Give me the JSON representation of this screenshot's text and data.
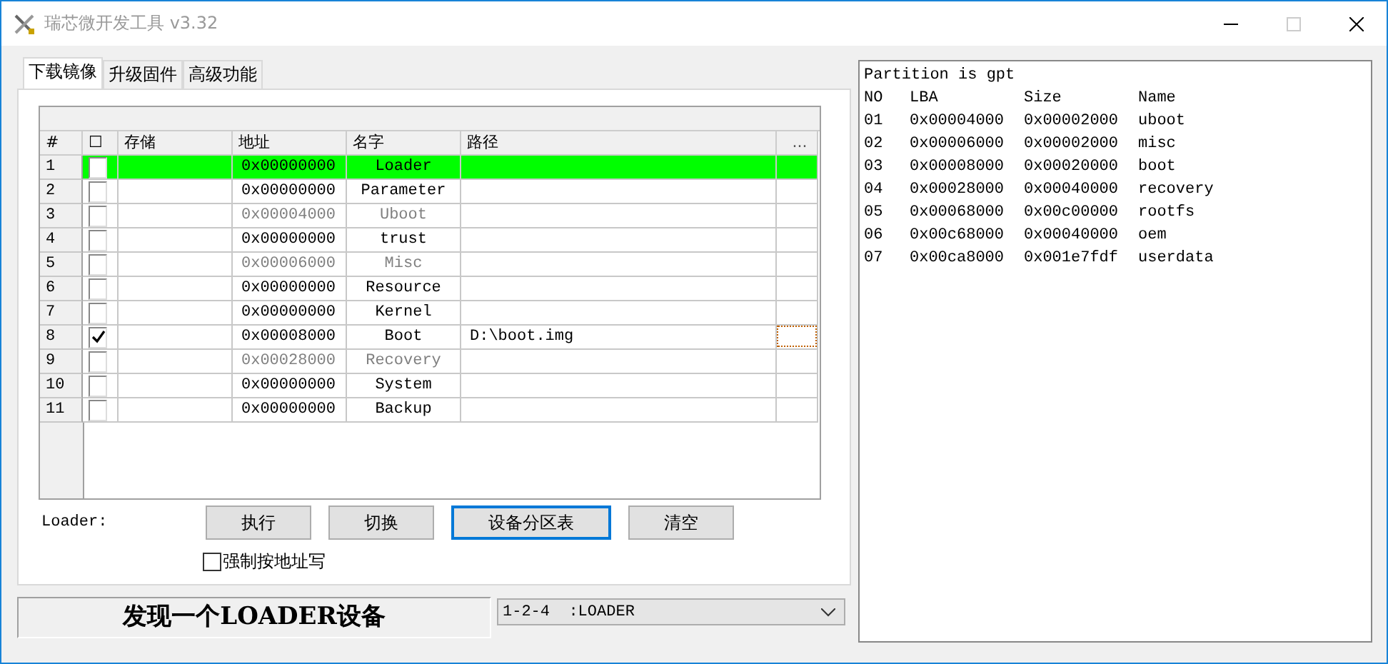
{
  "window": {
    "title": "瑞芯微开发工具 v3.32"
  },
  "tabs": [
    {
      "label": "下载镜像",
      "selected": true
    },
    {
      "label": "升级固件",
      "selected": false
    },
    {
      "label": "高级功能",
      "selected": false
    }
  ],
  "table": {
    "columns": [
      "#",
      "☐",
      "存储",
      "地址",
      "名字",
      "路径",
      "..."
    ],
    "rows": [
      {
        "no": "1",
        "checked": false,
        "selected": true,
        "disabled": false,
        "focused": false,
        "address": "0x00000000",
        "name": "Loader",
        "path": ""
      },
      {
        "no": "2",
        "checked": false,
        "selected": false,
        "disabled": false,
        "focused": false,
        "address": "0x00000000",
        "name": "Parameter",
        "path": ""
      },
      {
        "no": "3",
        "checked": false,
        "selected": false,
        "disabled": true,
        "focused": false,
        "address": "0x00004000",
        "name": "Uboot",
        "path": ""
      },
      {
        "no": "4",
        "checked": false,
        "selected": false,
        "disabled": false,
        "focused": false,
        "address": "0x00000000",
        "name": "trust",
        "path": ""
      },
      {
        "no": "5",
        "checked": false,
        "selected": false,
        "disabled": true,
        "focused": false,
        "address": "0x00006000",
        "name": "Misc",
        "path": ""
      },
      {
        "no": "6",
        "checked": false,
        "selected": false,
        "disabled": false,
        "focused": false,
        "address": "0x00000000",
        "name": "Resource",
        "path": ""
      },
      {
        "no": "7",
        "checked": false,
        "selected": false,
        "disabled": false,
        "focused": false,
        "address": "0x00000000",
        "name": "Kernel",
        "path": ""
      },
      {
        "no": "8",
        "checked": true,
        "selected": false,
        "disabled": false,
        "focused": true,
        "address": "0x00008000",
        "name": "Boot",
        "path": "D:\\boot.img"
      },
      {
        "no": "9",
        "checked": false,
        "selected": false,
        "disabled": true,
        "focused": false,
        "address": "0x00028000",
        "name": "Recovery",
        "path": ""
      },
      {
        "no": "10",
        "checked": false,
        "selected": false,
        "disabled": false,
        "focused": false,
        "address": "0x00000000",
        "name": "System",
        "path": ""
      },
      {
        "no": "11",
        "checked": false,
        "selected": false,
        "disabled": false,
        "focused": false,
        "address": "0x00000000",
        "name": "Backup",
        "path": ""
      }
    ]
  },
  "loader_label": "Loader:",
  "buttons": [
    {
      "label": "执行",
      "focused": false
    },
    {
      "label": "切换",
      "focused": false
    },
    {
      "label": "设备分区表",
      "focused": true
    },
    {
      "label": "清空",
      "focused": false
    }
  ],
  "force_address": {
    "label": "强制按地址写",
    "checked": false
  },
  "status": "发现一个LOADER设备",
  "device_select": {
    "value": "1-2-4  :LOADER"
  },
  "log": {
    "header": "Partition is gpt",
    "columns": [
      "NO",
      "LBA",
      "Size",
      "Name"
    ],
    "rows": [
      [
        "01",
        "0x00004000",
        "0x00002000",
        "uboot"
      ],
      [
        "02",
        "0x00006000",
        "0x00002000",
        "misc"
      ],
      [
        "03",
        "0x00008000",
        "0x00020000",
        "boot"
      ],
      [
        "04",
        "0x00028000",
        "0x00040000",
        "recovery"
      ],
      [
        "05",
        "0x00068000",
        "0x00c00000",
        "rootfs"
      ],
      [
        "06",
        "0x00c68000",
        "0x00040000",
        "oem"
      ],
      [
        "07",
        "0x00ca8000",
        "0x001e7fdf",
        "userdata"
      ]
    ]
  }
}
